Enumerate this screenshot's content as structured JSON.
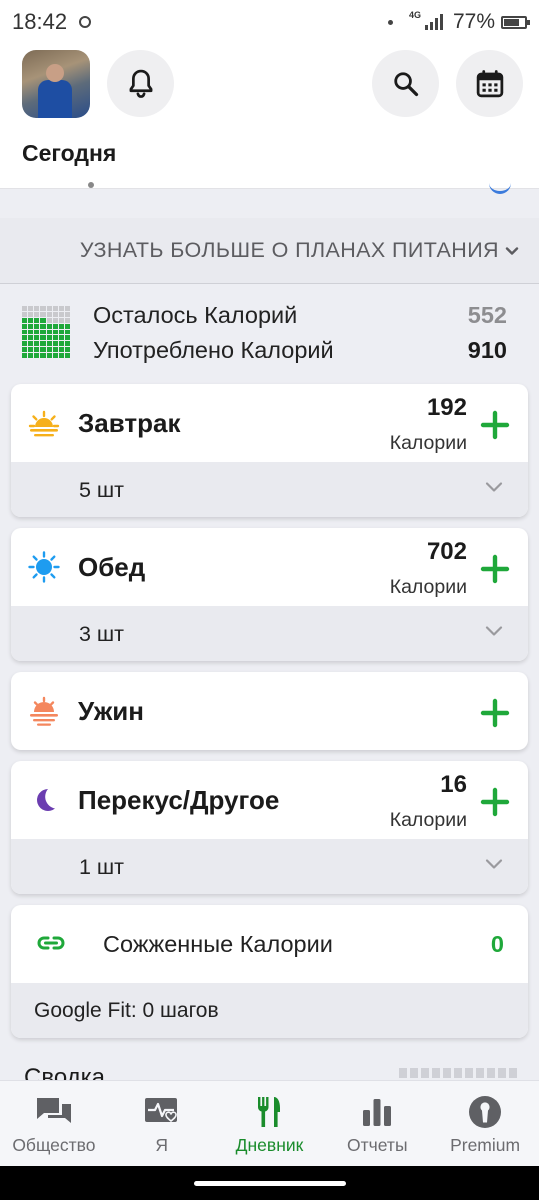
{
  "status_bar": {
    "time": "18:42",
    "network": "4G",
    "battery": "77%"
  },
  "header": {
    "page_title": "Сегодня",
    "icons": [
      "avatar",
      "bell-icon",
      "search-icon",
      "calendar-icon"
    ]
  },
  "learn_more": {
    "label": "УЗНАТЬ БОЛЬШЕ О ПЛАНАХ ПИТАНИЯ"
  },
  "summary": {
    "remaining_label": "Осталось Калорий",
    "remaining_value": "552",
    "consumed_label": "Употреблено Калорий",
    "consumed_value": "910"
  },
  "meals": [
    {
      "name": "Завтрак",
      "icon": "sunrise-icon",
      "calories": "192",
      "unit": "Калории",
      "count": "5 шт"
    },
    {
      "name": "Обед",
      "icon": "sun-icon",
      "calories": "702",
      "unit": "Калории",
      "count": "3 шт"
    },
    {
      "name": "Ужин",
      "icon": "sunset-icon"
    },
    {
      "name": "Перекус/Другое",
      "icon": "moon-icon",
      "calories": "16",
      "unit": "Калории",
      "count": "1 шт"
    }
  ],
  "burned": {
    "label": "Сожженные Калории",
    "value": "0",
    "google_fit": "Google Fit: 0 шагов"
  },
  "peek_summary": "Сводка",
  "bottom_nav": [
    {
      "label": "Общество",
      "icon": "chat-icon"
    },
    {
      "label": "Я",
      "icon": "health-icon"
    },
    {
      "label": "Дневник",
      "icon": "cutlery-icon",
      "active": true
    },
    {
      "label": "Отчеты",
      "icon": "bar-chart-icon"
    },
    {
      "label": "Premium",
      "icon": "premium-icon"
    }
  ],
  "colors": {
    "accent_green": "#1fa83a",
    "active_nav_green": "#1a8c2c",
    "remaining_gray": "#8d8d90",
    "sun_yellow": "#f6b01b",
    "sun_blue": "#1e9cf0",
    "sunset_orange": "#f4875e",
    "moon_purple": "#6b3db0"
  }
}
